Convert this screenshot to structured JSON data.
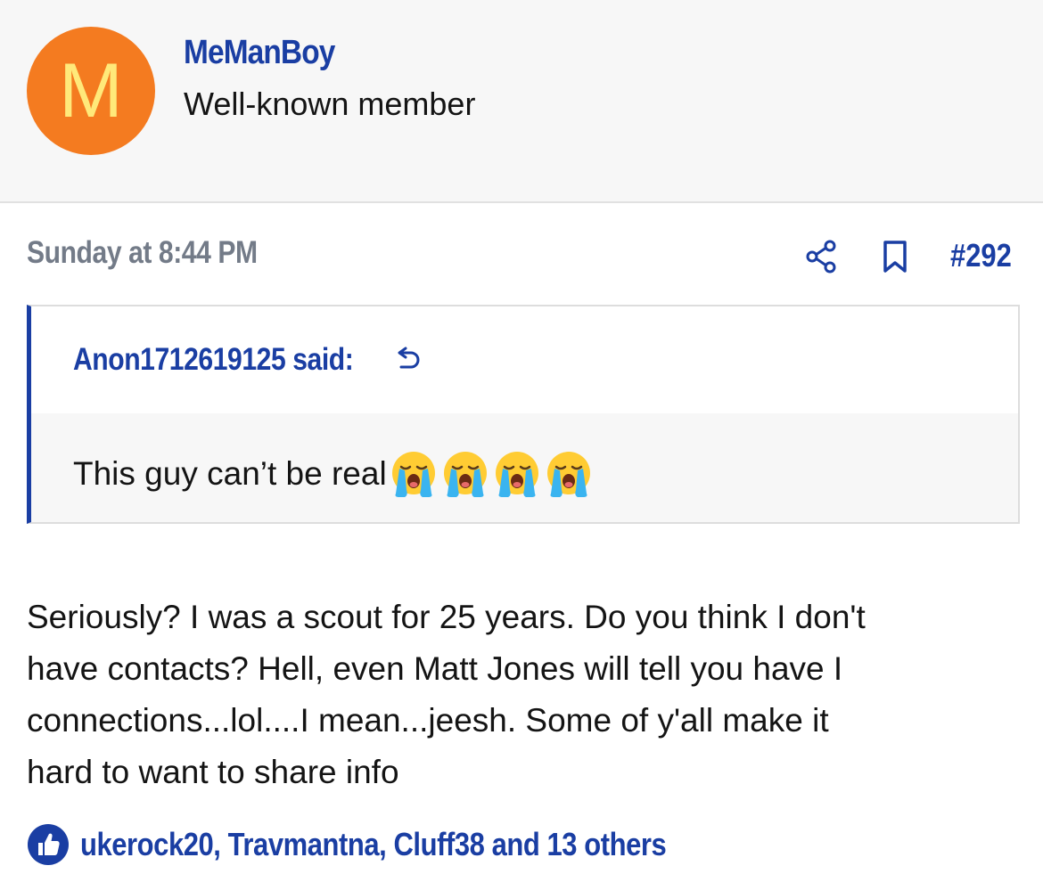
{
  "user": {
    "avatar_letter": "M",
    "avatar_bg": "#f47b20",
    "avatar_fg": "#ffe97a",
    "name": "MeManBoy",
    "title": "Well-known member"
  },
  "post": {
    "date": "Sunday at 8:44 PM",
    "number": "#292",
    "share_icon": "share-icon",
    "bookmark_icon": "bookmark-icon"
  },
  "quote": {
    "author_said": "Anon1712619125 said:",
    "jump_icon": "reply-arrow-icon",
    "text": "This guy can’t be real",
    "emoji": [
      "loudly-crying-face",
      "loudly-crying-face",
      "loudly-crying-face",
      "loudly-crying-face"
    ]
  },
  "message": {
    "lines": [
      "Seriously? I was a scout for 25 years. Do you think I don't",
      "have contacts? Hell, even Matt Jones will tell you have I",
      "connections...lol....I mean...jeesh. Some of y'all make it",
      "hard to want to share info"
    ]
  },
  "reactions": {
    "icon": "thumbs-up-icon",
    "users_text": "ukerock20, Travmantna, Cluff38 and 13 others"
  },
  "colors": {
    "link": "#1a3ea3",
    "muted": "#737b88",
    "header_bg": "#f7f7f7"
  }
}
